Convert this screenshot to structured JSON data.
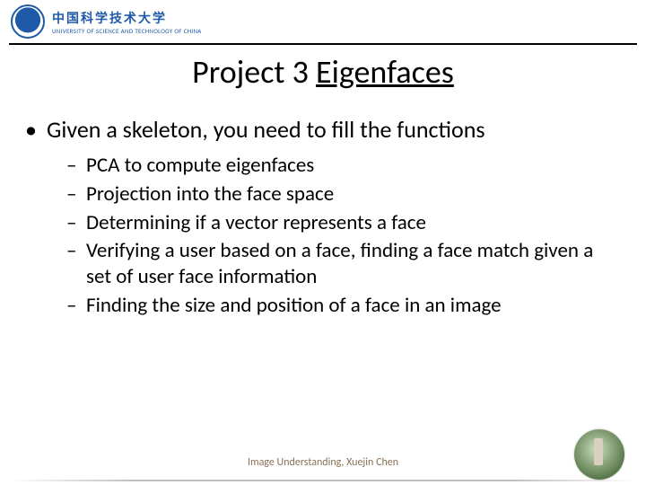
{
  "header": {
    "uni_cn": "中国科学技术大学",
    "uni_en": "UNIVERSITY OF SCIENCE AND TECHNOLOGY OF CHINA"
  },
  "title": {
    "prefix": "Project 3  ",
    "link": "Eigenfaces"
  },
  "bullets": {
    "l1": "Given a skeleton, you need to fill the functions",
    "l2": [
      "PCA to compute eigenfaces",
      "Projection into the face space",
      "Determining if a vector represents a face",
      "Verifying a user based on a face, finding a face match given a set of user face information",
      "Finding the size and position of a face in an image"
    ]
  },
  "footer": "Image Understanding, Xuejin Chen"
}
